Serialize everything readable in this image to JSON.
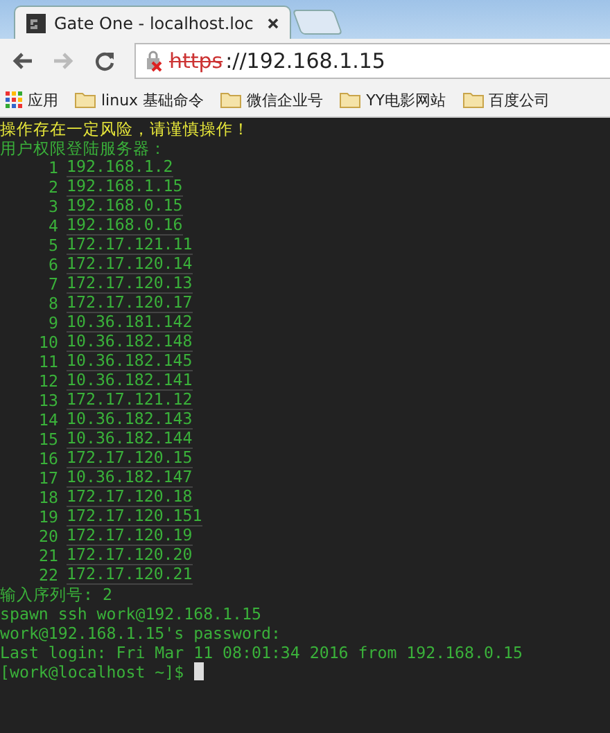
{
  "browser": {
    "tab_title": "Gate One - localhost.loc",
    "url_scheme": "https",
    "url_rest": "://192.168.1.15",
    "bookmarks": [
      {
        "label": "应用",
        "kind": "apps"
      },
      {
        "label": "linux 基础命令",
        "kind": "folder"
      },
      {
        "label": "微信企业号",
        "kind": "folder"
      },
      {
        "label": "YY电影网站",
        "kind": "folder"
      },
      {
        "label": "百度公司",
        "kind": "folder"
      }
    ]
  },
  "terminal": {
    "warning": "操作存在一定风险，请谨慎操作！",
    "header": "用户权限登陆服务器：",
    "servers": [
      {
        "number": "1",
        "ip": "192.168.1.2"
      },
      {
        "number": "2",
        "ip": "192.168.1.15"
      },
      {
        "number": "3",
        "ip": "192.168.0.15"
      },
      {
        "number": "4",
        "ip": "192.168.0.16"
      },
      {
        "number": "5",
        "ip": "172.17.121.11"
      },
      {
        "number": "6",
        "ip": "172.17.120.14"
      },
      {
        "number": "7",
        "ip": "172.17.120.13"
      },
      {
        "number": "8",
        "ip": "172.17.120.17"
      },
      {
        "number": "9",
        "ip": "10.36.181.142"
      },
      {
        "number": "10",
        "ip": "10.36.182.148"
      },
      {
        "number": "11",
        "ip": "10.36.182.145"
      },
      {
        "number": "12",
        "ip": "10.36.182.141"
      },
      {
        "number": "13",
        "ip": "172.17.121.12"
      },
      {
        "number": "14",
        "ip": "10.36.182.143"
      },
      {
        "number": "15",
        "ip": "10.36.182.144"
      },
      {
        "number": "16",
        "ip": "172.17.120.15"
      },
      {
        "number": "17",
        "ip": "10.36.182.147"
      },
      {
        "number": "18",
        "ip": "172.17.120.18"
      },
      {
        "number": "19",
        "ip": "172.17.120.151"
      },
      {
        "number": "20",
        "ip": "172.17.120.19"
      },
      {
        "number": "21",
        "ip": "172.17.120.20"
      },
      {
        "number": "22",
        "ip": "172.17.120.21"
      }
    ],
    "lines": [
      "输入序列号: 2",
      "spawn ssh work@192.168.1.15",
      "work@192.168.1.15's password:",
      "Last login: Fri Mar 11 08:01:34 2016 from 192.168.0.15"
    ],
    "prompt": "[work@localhost ~]$"
  }
}
